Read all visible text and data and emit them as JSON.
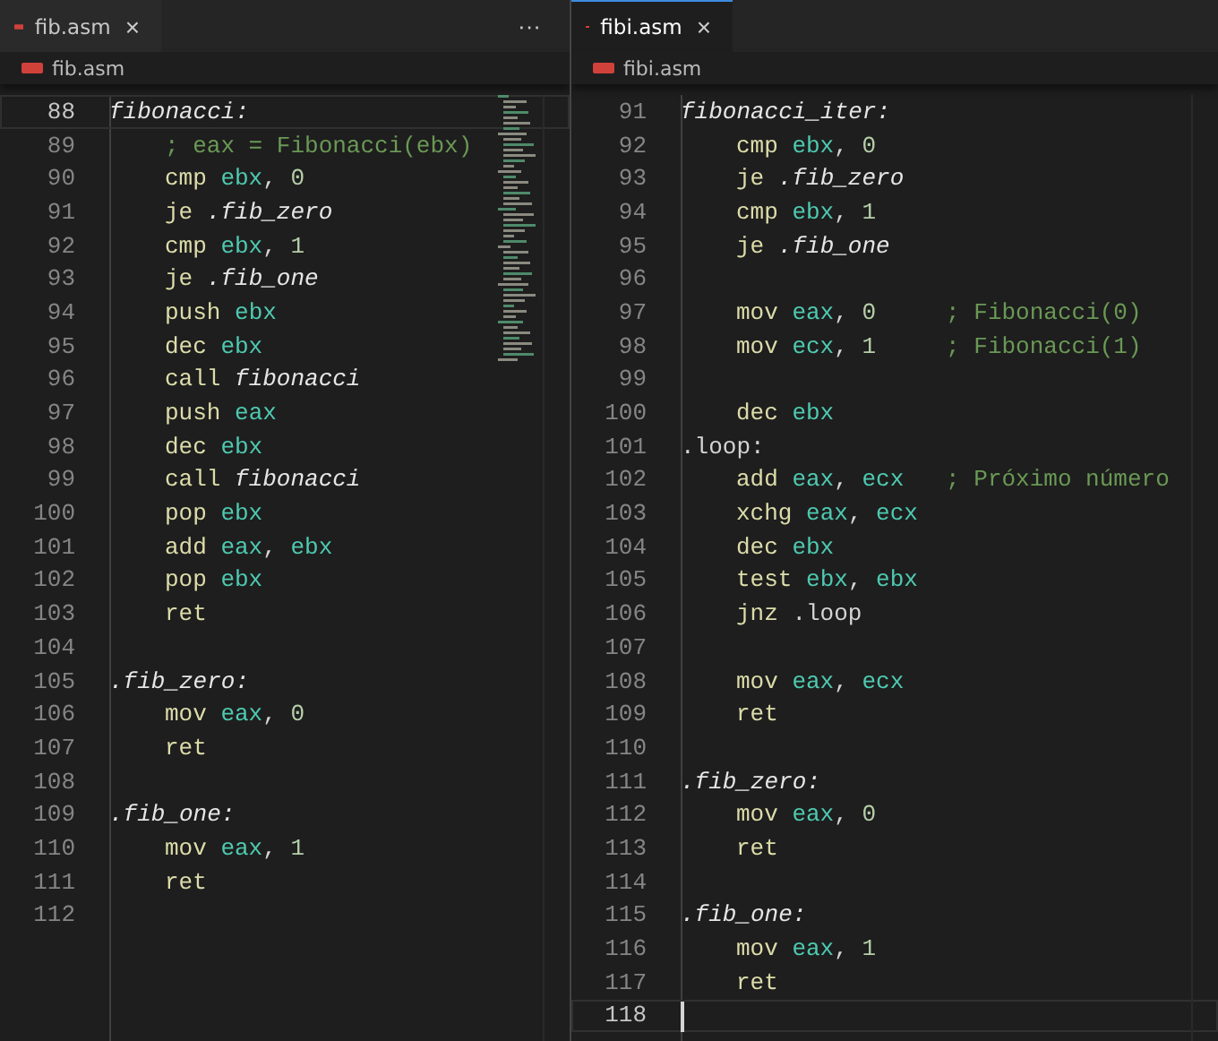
{
  "panes": [
    {
      "tab": {
        "label": "fib.asm",
        "selected": false,
        "close": "×"
      },
      "more": "···",
      "breadcrumb": "fib.asm",
      "lines": [
        {
          "number": "88",
          "current": true,
          "indented": false,
          "tokens": [
            {
              "kind": "l",
              "text": "fibonacci:"
            }
          ]
        },
        {
          "number": "89",
          "current": false,
          "indented": true,
          "tokens": [
            {
              "kind": "c",
              "text": "; eax = Fibonacci(ebx)"
            }
          ]
        },
        {
          "number": "90",
          "current": false,
          "indented": true,
          "tokens": [
            {
              "kind": "k",
              "text": "cmp"
            },
            {
              "kind": "r",
              "text": " ebx"
            },
            {
              "kind": "p",
              "text": ", "
            },
            {
              "kind": "n",
              "text": "0"
            }
          ]
        },
        {
          "number": "91",
          "current": false,
          "indented": true,
          "tokens": [
            {
              "kind": "k",
              "text": "je"
            },
            {
              "kind": "l",
              "text": " .fib_zero"
            }
          ]
        },
        {
          "number": "92",
          "current": false,
          "indented": true,
          "tokens": [
            {
              "kind": "k",
              "text": "cmp"
            },
            {
              "kind": "r",
              "text": " ebx"
            },
            {
              "kind": "p",
              "text": ", "
            },
            {
              "kind": "n",
              "text": "1"
            }
          ]
        },
        {
          "number": "93",
          "current": false,
          "indented": true,
          "tokens": [
            {
              "kind": "k",
              "text": "je"
            },
            {
              "kind": "l",
              "text": " .fib_one"
            }
          ]
        },
        {
          "number": "94",
          "current": false,
          "indented": true,
          "tokens": [
            {
              "kind": "k",
              "text": "push"
            },
            {
              "kind": "r",
              "text": " ebx"
            }
          ]
        },
        {
          "number": "95",
          "current": false,
          "indented": true,
          "tokens": [
            {
              "kind": "k",
              "text": "dec"
            },
            {
              "kind": "r",
              "text": " ebx"
            }
          ]
        },
        {
          "number": "96",
          "current": false,
          "indented": true,
          "tokens": [
            {
              "kind": "k",
              "text": "call"
            },
            {
              "kind": "l",
              "text": " fibonacci"
            }
          ]
        },
        {
          "number": "97",
          "current": false,
          "indented": true,
          "tokens": [
            {
              "kind": "k",
              "text": "push"
            },
            {
              "kind": "r",
              "text": " eax"
            }
          ]
        },
        {
          "number": "98",
          "current": false,
          "indented": true,
          "tokens": [
            {
              "kind": "k",
              "text": "dec"
            },
            {
              "kind": "r",
              "text": " ebx"
            }
          ]
        },
        {
          "number": "99",
          "current": false,
          "indented": true,
          "tokens": [
            {
              "kind": "k",
              "text": "call"
            },
            {
              "kind": "l",
              "text": " fibonacci"
            }
          ]
        },
        {
          "number": "100",
          "current": false,
          "indented": true,
          "tokens": [
            {
              "kind": "k",
              "text": "pop"
            },
            {
              "kind": "r",
              "text": " ebx"
            }
          ]
        },
        {
          "number": "101",
          "current": false,
          "indented": true,
          "tokens": [
            {
              "kind": "k",
              "text": "add"
            },
            {
              "kind": "r",
              "text": " eax"
            },
            {
              "kind": "p",
              "text": ", "
            },
            {
              "kind": "r",
              "text": "ebx"
            }
          ]
        },
        {
          "number": "102",
          "current": false,
          "indented": true,
          "tokens": [
            {
              "kind": "k",
              "text": "pop"
            },
            {
              "kind": "r",
              "text": " ebx"
            }
          ]
        },
        {
          "number": "103",
          "current": false,
          "indented": true,
          "tokens": [
            {
              "kind": "k",
              "text": "ret"
            }
          ]
        },
        {
          "number": "104",
          "current": false
        },
        {
          "number": "105",
          "current": false,
          "indented": false,
          "tokens": [
            {
              "kind": "l",
              "text": ".fib_zero:"
            }
          ]
        },
        {
          "number": "106",
          "current": false,
          "indented": true,
          "tokens": [
            {
              "kind": "k",
              "text": "mov"
            },
            {
              "kind": "r",
              "text": " eax"
            },
            {
              "kind": "p",
              "text": ", "
            },
            {
              "kind": "n",
              "text": "0"
            }
          ]
        },
        {
          "number": "107",
          "current": false,
          "indented": true,
          "tokens": [
            {
              "kind": "k",
              "text": "ret"
            }
          ]
        },
        {
          "number": "108",
          "current": false
        },
        {
          "number": "109",
          "current": false,
          "indented": false,
          "tokens": [
            {
              "kind": "l",
              "text": ".fib_one:"
            }
          ]
        },
        {
          "number": "110",
          "current": false,
          "indented": true,
          "tokens": [
            {
              "kind": "k",
              "text": "mov"
            },
            {
              "kind": "r",
              "text": " eax"
            },
            {
              "kind": "p",
              "text": ", "
            },
            {
              "kind": "n",
              "text": "1"
            }
          ]
        },
        {
          "number": "111",
          "current": false,
          "indented": true,
          "tokens": [
            {
              "kind": "k",
              "text": "ret"
            }
          ]
        },
        {
          "number": "112",
          "current": false
        }
      ]
    },
    {
      "tab": {
        "label": "fibi.asm",
        "selected": true,
        "close": "×"
      },
      "breadcrumb": "fibi.asm",
      "lines": [
        {
          "number": "91",
          "current": false,
          "indented": false,
          "tokens": [
            {
              "kind": "l",
              "text": "fibonacci_iter:"
            }
          ]
        },
        {
          "number": "92",
          "current": false,
          "indented": true,
          "tokens": [
            {
              "kind": "k",
              "text": "cmp"
            },
            {
              "kind": "r",
              "text": " ebx"
            },
            {
              "kind": "p",
              "text": ", "
            },
            {
              "kind": "n",
              "text": "0"
            }
          ]
        },
        {
          "number": "93",
          "current": false,
          "indented": true,
          "tokens": [
            {
              "kind": "k",
              "text": "je"
            },
            {
              "kind": "l",
              "text": " .fib_zero"
            }
          ]
        },
        {
          "number": "94",
          "current": false,
          "indented": true,
          "tokens": [
            {
              "kind": "k",
              "text": "cmp"
            },
            {
              "kind": "r",
              "text": " ebx"
            },
            {
              "kind": "p",
              "text": ", "
            },
            {
              "kind": "n",
              "text": "1"
            }
          ]
        },
        {
          "number": "95",
          "current": false,
          "indented": true,
          "tokens": [
            {
              "kind": "k",
              "text": "je"
            },
            {
              "kind": "l",
              "text": " .fib_one"
            }
          ]
        },
        {
          "number": "96",
          "current": false
        },
        {
          "number": "97",
          "current": false,
          "indented": true,
          "tokens": [
            {
              "kind": "k",
              "text": "mov"
            },
            {
              "kind": "r",
              "text": " eax"
            },
            {
              "kind": "p",
              "text": ", "
            },
            {
              "kind": "n",
              "text": "0"
            },
            {
              "kind": "c",
              "text": "     ; Fibonacci(0)"
            }
          ]
        },
        {
          "number": "98",
          "current": false,
          "indented": true,
          "tokens": [
            {
              "kind": "k",
              "text": "mov"
            },
            {
              "kind": "r",
              "text": " ecx"
            },
            {
              "kind": "p",
              "text": ", "
            },
            {
              "kind": "n",
              "text": "1"
            },
            {
              "kind": "c",
              "text": "     ; Fibonacci(1)"
            }
          ]
        },
        {
          "number": "99",
          "current": false
        },
        {
          "number": "100",
          "current": false,
          "indented": true,
          "tokens": [
            {
              "kind": "k",
              "text": "dec"
            },
            {
              "kind": "r",
              "text": " ebx"
            }
          ]
        },
        {
          "number": "101",
          "current": false,
          "indented": false,
          "tokens": [
            {
              "kind": "p",
              "text": ".loop:"
            }
          ]
        },
        {
          "number": "102",
          "current": false,
          "indented": true,
          "tokens": [
            {
              "kind": "k",
              "text": "add"
            },
            {
              "kind": "r",
              "text": " eax"
            },
            {
              "kind": "p",
              "text": ", "
            },
            {
              "kind": "r",
              "text": "ecx"
            },
            {
              "kind": "c",
              "text": "   ; Próximo número"
            }
          ]
        },
        {
          "number": "103",
          "current": false,
          "indented": true,
          "tokens": [
            {
              "kind": "k",
              "text": "xchg"
            },
            {
              "kind": "r",
              "text": " eax"
            },
            {
              "kind": "p",
              "text": ", "
            },
            {
              "kind": "r",
              "text": "ecx"
            }
          ]
        },
        {
          "number": "104",
          "current": false,
          "indented": true,
          "tokens": [
            {
              "kind": "k",
              "text": "dec"
            },
            {
              "kind": "r",
              "text": " ebx"
            }
          ]
        },
        {
          "number": "105",
          "current": false,
          "indented": true,
          "tokens": [
            {
              "kind": "k",
              "text": "test"
            },
            {
              "kind": "r",
              "text": " ebx"
            },
            {
              "kind": "p",
              "text": ", "
            },
            {
              "kind": "r",
              "text": "ebx"
            }
          ]
        },
        {
          "number": "106",
          "current": false,
          "indented": true,
          "tokens": [
            {
              "kind": "k",
              "text": "jnz"
            },
            {
              "kind": "p",
              "text": " .loop"
            }
          ]
        },
        {
          "number": "107",
          "current": false
        },
        {
          "number": "108",
          "current": false,
          "indented": true,
          "tokens": [
            {
              "kind": "k",
              "text": "mov"
            },
            {
              "kind": "r",
              "text": " eax"
            },
            {
              "kind": "p",
              "text": ", "
            },
            {
              "kind": "r",
              "text": "ecx"
            }
          ]
        },
        {
          "number": "109",
          "current": false,
          "indented": true,
          "tokens": [
            {
              "kind": "k",
              "text": "ret"
            }
          ]
        },
        {
          "number": "110",
          "current": false
        },
        {
          "number": "111",
          "current": false,
          "indented": false,
          "tokens": [
            {
              "kind": "l",
              "text": ".fib_zero:"
            }
          ]
        },
        {
          "number": "112",
          "current": false,
          "indented": true,
          "tokens": [
            {
              "kind": "k",
              "text": "mov"
            },
            {
              "kind": "r",
              "text": " eax"
            },
            {
              "kind": "p",
              "text": ", "
            },
            {
              "kind": "n",
              "text": "0"
            }
          ]
        },
        {
          "number": "113",
          "current": false,
          "indented": true,
          "tokens": [
            {
              "kind": "k",
              "text": "ret"
            }
          ]
        },
        {
          "number": "114",
          "current": false
        },
        {
          "number": "115",
          "current": false,
          "indented": false,
          "tokens": [
            {
              "kind": "l",
              "text": ".fib_one:"
            }
          ]
        },
        {
          "number": "116",
          "current": false,
          "indented": true,
          "tokens": [
            {
              "kind": "k",
              "text": "mov"
            },
            {
              "kind": "r",
              "text": " eax"
            },
            {
              "kind": "p",
              "text": ", "
            },
            {
              "kind": "n",
              "text": "1"
            }
          ]
        },
        {
          "number": "117",
          "current": false,
          "indented": true,
          "tokens": [
            {
              "kind": "k",
              "text": "ret"
            }
          ]
        },
        {
          "number": "118",
          "current": true
        }
      ]
    }
  ]
}
